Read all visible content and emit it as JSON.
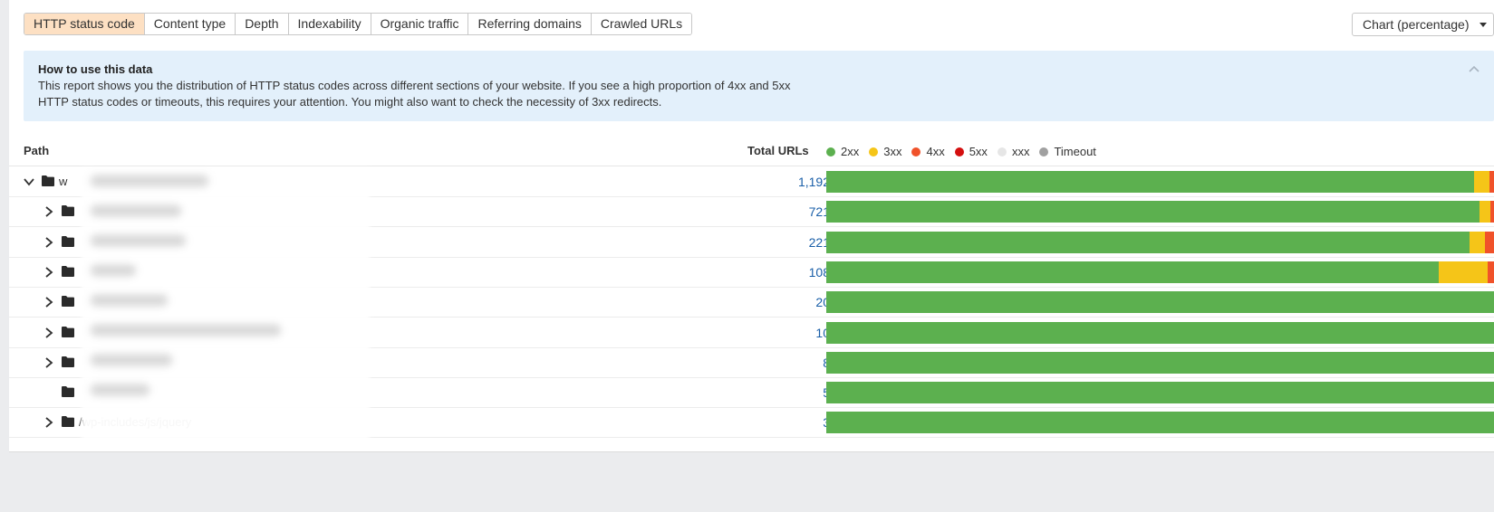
{
  "tabs": [
    {
      "label": "HTTP status code",
      "active": true
    },
    {
      "label": "Content type",
      "active": false
    },
    {
      "label": "Depth",
      "active": false
    },
    {
      "label": "Indexability",
      "active": false
    },
    {
      "label": "Organic traffic",
      "active": false
    },
    {
      "label": "Referring domains",
      "active": false
    },
    {
      "label": "Crawled URLs",
      "active": false
    }
  ],
  "view_select": {
    "label": "Chart (percentage)"
  },
  "info": {
    "title": "How to use this data",
    "text": "This report shows you the distribution of HTTP status codes across different sections of your website. If you see a high proportion of 4xx and 5xx HTTP status codes or timeouts, this requires your attention. You might also want to check the necessity of 3xx redirects."
  },
  "table": {
    "col_path": "Path",
    "col_total": "Total URLs",
    "legend": [
      {
        "label": "2xx",
        "color": "#5cb04f"
      },
      {
        "label": "3xx",
        "color": "#f5c518"
      },
      {
        "label": "4xx",
        "color": "#f0522a"
      },
      {
        "label": "5xx",
        "color": "#d40f0f"
      },
      {
        "label": "xxx",
        "color": "#e6e6e6"
      },
      {
        "label": "Timeout",
        "color": "#a0a0a0"
      }
    ],
    "rows": [
      {
        "path": "w",
        "total": "1,192",
        "expanded": true,
        "has_children": true,
        "indent": 0,
        "shares": [
          97.0,
          2.3,
          0.7,
          0,
          0,
          0
        ]
      },
      {
        "path": "",
        "total": "721",
        "expanded": false,
        "has_children": true,
        "indent": 1,
        "shares": [
          97.8,
          1.7,
          0.5,
          0,
          0,
          0
        ]
      },
      {
        "path": "",
        "total": "221",
        "expanded": false,
        "has_children": true,
        "indent": 1,
        "shares": [
          96.4,
          2.3,
          1.3,
          0,
          0,
          0
        ]
      },
      {
        "path": "",
        "total": "108",
        "expanded": false,
        "has_children": true,
        "indent": 1,
        "shares": [
          91.7,
          7.4,
          0.9,
          0,
          0,
          0
        ]
      },
      {
        "path": "",
        "total": "20",
        "expanded": false,
        "has_children": true,
        "indent": 1,
        "shares": [
          100,
          0,
          0,
          0,
          0,
          0
        ]
      },
      {
        "path": "",
        "total": "10",
        "expanded": false,
        "has_children": true,
        "indent": 1,
        "shares": [
          100,
          0,
          0,
          0,
          0,
          0
        ]
      },
      {
        "path": "",
        "total": "8",
        "expanded": false,
        "has_children": true,
        "indent": 1,
        "shares": [
          100,
          0,
          0,
          0,
          0,
          0
        ]
      },
      {
        "path": "",
        "total": "5",
        "expanded": false,
        "has_children": false,
        "indent": 1,
        "shares": [
          100,
          0,
          0,
          0,
          0,
          0
        ]
      },
      {
        "path": "/wp-includes/js/jquery",
        "total": "3",
        "expanded": false,
        "has_children": true,
        "indent": 1,
        "shares": [
          100,
          0,
          0,
          0,
          0,
          0
        ]
      }
    ]
  }
}
